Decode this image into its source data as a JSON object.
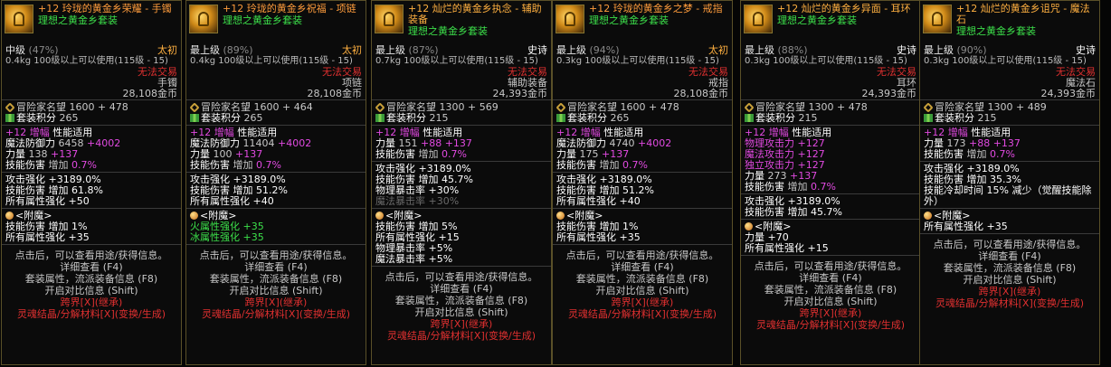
{
  "common": {
    "set_name": "理想之黄金乡套装",
    "fame_label": "冒险家名望",
    "setpts_label": "套装积分",
    "amp_label": "增幅",
    "perf_label": "性能适用",
    "not_tradable": "无法交易",
    "enchant_label": "<附魔>",
    "footer": {
      "click": "点击后，可以查看用途/获得信息。",
      "detail": "详细查看 (F4)",
      "set_attr": "套装属性，流派装备信息 (F8)",
      "compare": "开启对比信息 (Shift)",
      "cross": "跨界[X](继承)",
      "soul": "灵魂结晶/分解材料[X](变换/生成)"
    }
  },
  "items": [
    {
      "name": "+12 玲珑的黄金乡荣耀 - 手镯",
      "grade": "中级",
      "grade_pct": "(47%)",
      "rarity": "太初",
      "weight": "0.4kg",
      "req": "100级以上可以使用(115级 - 15)",
      "type": "手镯",
      "price": "28,108金币",
      "fame_base": "1600",
      "fame_add": "+ 478",
      "setpts": "265",
      "amp": "+12",
      "stats": [
        {
          "l": "魔法防御力",
          "v": "6458",
          "a": "+4002"
        },
        {
          "l": "力量",
          "v": "138",
          "a": "+137"
        },
        {
          "l": "技能伤害",
          "v": "增加",
          "a": "0.7%"
        }
      ],
      "sub": [
        {
          "l": "攻击强化",
          "v": "+3189.0%",
          "a": ""
        },
        {
          "l": "技能伤害",
          "v": "增加 61.8%",
          "a": ""
        },
        {
          "l": "所有属性强化",
          "v": "+50",
          "a": ""
        }
      ],
      "enchant": [
        {
          "l": "技能伤害",
          "v": "增加 1%"
        },
        {
          "l": "所有属性强化",
          "v": "+35"
        }
      ]
    },
    {
      "name": "+12 玲珑的黄金乡祝福 - 项链",
      "grade": "最上级",
      "grade_pct": "(89%)",
      "rarity": "太初",
      "weight": "0.4kg",
      "req": "100级以上可以使用(115级 - 15)",
      "type": "项链",
      "price": "28,108金币",
      "fame_base": "1600",
      "fame_add": "+ 464",
      "setpts": "265",
      "amp": "+12",
      "stats": [
        {
          "l": "魔法防御力",
          "v": "11404",
          "a": "+4002"
        },
        {
          "l": "力量",
          "v": "100",
          "a": "+137"
        },
        {
          "l": "技能伤害",
          "v": "增加",
          "a": "0.7%"
        }
      ],
      "sub": [
        {
          "l": "攻击强化",
          "v": "+3189.0%",
          "a": ""
        },
        {
          "l": "技能伤害",
          "v": "增加 51.2%",
          "a": ""
        },
        {
          "l": "所有属性强化",
          "v": "+40",
          "a": ""
        }
      ],
      "enchant": [
        {
          "l": "火属性强化",
          "v": "+35"
        },
        {
          "l": "冰属性强化",
          "v": "+35"
        }
      ]
    },
    {
      "name": "+12 灿烂的黄金乡执念 - 辅助装备",
      "grade": "最上级",
      "grade_pct": "(87%)",
      "rarity": "史诗",
      "weight": "0.7kg",
      "req": "100级以上可以使用(115级 - 15)",
      "type": "辅助装备",
      "price": "24,393金币",
      "fame_base": "1300",
      "fame_add": "+ 569",
      "setpts": "215",
      "amp": "+12",
      "stats": [
        {
          "l": "力量",
          "v": "151",
          "a": "+88 +137"
        },
        {
          "l": "技能伤害",
          "v": "增加",
          "a": "0.7%"
        }
      ],
      "sub": [
        {
          "l": "攻击强化",
          "v": "+3189.0%",
          "a": ""
        },
        {
          "l": "技能伤害",
          "v": "增加 45.7%",
          "a": ""
        },
        {
          "l": "物理暴击率",
          "v": "+30%",
          "a": ""
        },
        {
          "l": "魔法暴击率",
          "v": "+30%",
          "a": "dim"
        }
      ],
      "enchant": [
        {
          "l": "技能伤害",
          "v": "增加 5%"
        },
        {
          "l": "所有属性强化",
          "v": "+15"
        },
        {
          "l": "物理暴击率",
          "v": "+5%"
        },
        {
          "l": "魔法暴击率",
          "v": "+5%"
        }
      ]
    },
    {
      "name": "+12 玲珑的黄金乡之梦 - 戒指",
      "grade": "最上级",
      "grade_pct": "(94%)",
      "rarity": "太初",
      "weight": "0.3kg",
      "req": "100级以上可以使用(115级 - 15)",
      "type": "戒指",
      "price": "28,108金币",
      "fame_base": "1600",
      "fame_add": "+ 478",
      "setpts": "265",
      "amp": "+12",
      "stats": [
        {
          "l": "魔法防御力",
          "v": "4740",
          "a": "+4002"
        },
        {
          "l": "力量",
          "v": "175",
          "a": "+137"
        },
        {
          "l": "技能伤害",
          "v": "增加",
          "a": "0.7%"
        }
      ],
      "sub": [
        {
          "l": "攻击强化",
          "v": "+3189.0%",
          "a": ""
        },
        {
          "l": "技能伤害",
          "v": "增加 51.2%",
          "a": ""
        },
        {
          "l": "所有属性强化",
          "v": "+40",
          "a": ""
        }
      ],
      "enchant": [
        {
          "l": "技能伤害",
          "v": "增加 1%"
        },
        {
          "l": "所有属性强化",
          "v": "+35"
        }
      ]
    },
    {
      "name": "+12 灿烂的黄金乡异面 - 耳环",
      "grade": "最上级",
      "grade_pct": "(88%)",
      "rarity": "史诗",
      "weight": "0.3kg",
      "req": "100级以上可以使用(115级 - 15)",
      "type": "耳环",
      "price": "24,393金币",
      "fame_base": "1300",
      "fame_add": "+ 478",
      "setpts": "215",
      "amp": "+12",
      "stats": [
        {
          "l": "物理攻击力",
          "v": "",
          "a": "+127"
        },
        {
          "l": "魔法攻击力",
          "v": "",
          "a": "+127"
        },
        {
          "l": "独立攻击力",
          "v": "",
          "a": "+127"
        },
        {
          "l": "力量",
          "v": "273",
          "a": "+137"
        },
        {
          "l": "技能伤害",
          "v": "增加",
          "a": "0.7%"
        }
      ],
      "sub": [
        {
          "l": "攻击强化",
          "v": "+3189.0%",
          "a": ""
        },
        {
          "l": "技能伤害",
          "v": "增加 45.7%",
          "a": ""
        }
      ],
      "enchant": [
        {
          "l": "力量",
          "v": "+70"
        },
        {
          "l": "所有属性强化",
          "v": "+15"
        }
      ]
    },
    {
      "name": "+12 灿烂的黄金乡诅咒 - 魔法石",
      "grade": "最上级",
      "grade_pct": "(90%)",
      "rarity": "史诗",
      "weight": "0.3kg",
      "req": "100级以上可以使用(115级 - 15)",
      "type": "魔法石",
      "price": "24,393金币",
      "fame_base": "1300",
      "fame_add": "+ 489",
      "setpts": "215",
      "amp": "+12",
      "stats": [
        {
          "l": "力量",
          "v": "173",
          "a": "+88 +137"
        },
        {
          "l": "技能伤害",
          "v": "增加",
          "a": "0.7%"
        }
      ],
      "sub": [
        {
          "l": "攻击强化",
          "v": "+3189.0%",
          "a": ""
        },
        {
          "l": "技能伤害",
          "v": "增加 35.3%",
          "a": ""
        },
        {
          "l": "技能冷却时间",
          "v": "15% 减少（觉醒技能除外）",
          "a": ""
        }
      ],
      "enchant": [
        {
          "l": "所有属性强化",
          "v": "+35"
        }
      ]
    }
  ]
}
